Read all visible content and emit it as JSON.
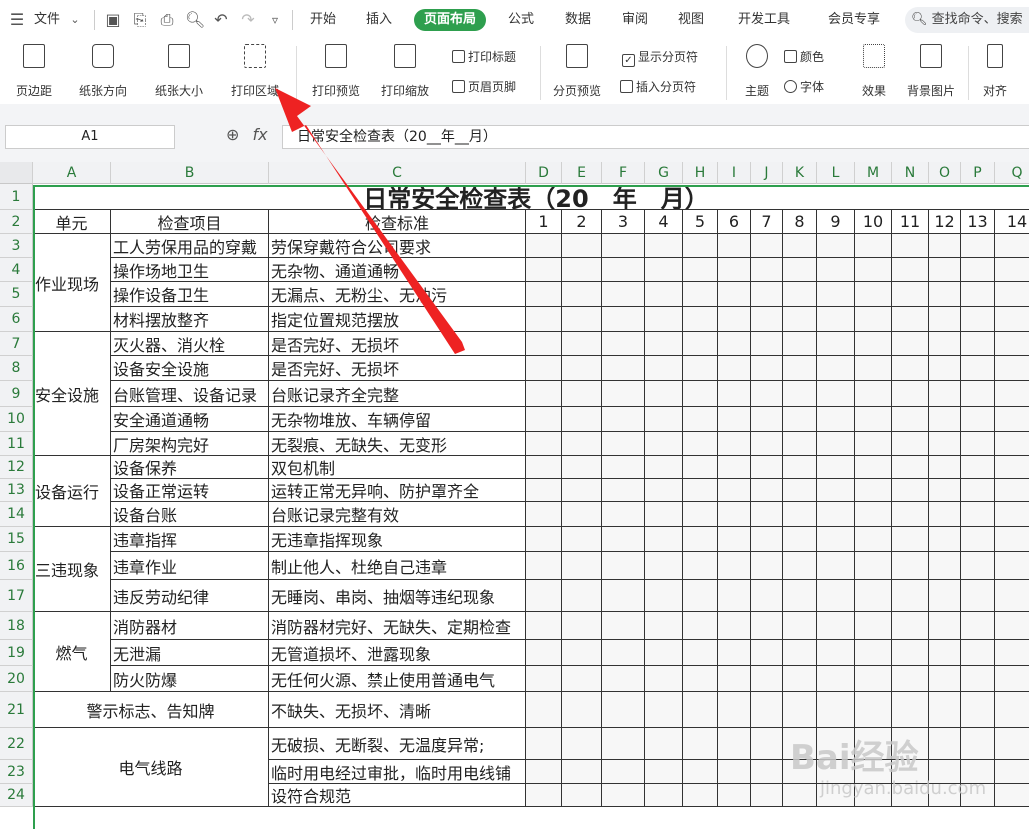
{
  "menubar": {
    "file_label": "文件",
    "tabs": [
      "开始",
      "插入",
      "页面布局",
      "公式",
      "数据",
      "审阅",
      "视图",
      "开发工具",
      "会员专享"
    ],
    "active_tab": "页面布局",
    "search_placeholder": "查找命令、搜索"
  },
  "ribbon": {
    "big_buttons": [
      "页边距",
      "纸张方向",
      "纸张大小",
      "打印区域",
      "打印预览",
      "打印缩放",
      "分页预览",
      "主题",
      "背景图片",
      "对齐"
    ],
    "small_buttons": [
      "打印标题",
      "页眉页脚",
      "显示分页符",
      "插入分页符",
      "颜色",
      "字体",
      "效果"
    ]
  },
  "formula_bar": {
    "cell_ref": "A1",
    "fx": "fx",
    "content": "日常安全检查表（20__年__月）"
  },
  "columns": [
    "A",
    "B",
    "C",
    "D",
    "E",
    "F",
    "G",
    "H",
    "I",
    "J",
    "K",
    "L",
    "M",
    "N",
    "O",
    "P",
    "Q"
  ],
  "rows": [
    "1",
    "2",
    "3",
    "4",
    "5",
    "6",
    "7",
    "8",
    "9",
    "10",
    "11",
    "12",
    "13",
    "14",
    "15",
    "16",
    "17",
    "18",
    "19",
    "20",
    "21",
    "22",
    "23",
    "24"
  ],
  "sheet": {
    "title": "日常安全检查表（20__年__月）",
    "headers": {
      "unit": "单元",
      "item": "检查项目",
      "standard": "检查标准"
    },
    "days": [
      "1",
      "2",
      "3",
      "4",
      "5",
      "6",
      "7",
      "8",
      "9",
      "10",
      "11",
      "12",
      "13",
      "14"
    ],
    "units": [
      {
        "name": "作业现场"
      },
      {
        "name": "安全设施"
      },
      {
        "name": "设备运行"
      },
      {
        "name": "三违现象"
      },
      {
        "name": "燃气"
      },
      {
        "name": "警示标志、告知牌"
      },
      {
        "name": "电气线路"
      }
    ],
    "items": [
      {
        "item": "工人劳保用品的穿戴",
        "standard": "劳保穿戴符合公司要求"
      },
      {
        "item": "操作场地卫生",
        "standard": "无杂物、通道通畅"
      },
      {
        "item": "操作设备卫生",
        "standard": "无漏点、无粉尘、无油污"
      },
      {
        "item": "材料摆放整齐",
        "standard": "指定位置规范摆放"
      },
      {
        "item": "灭火器、消火栓",
        "standard": "是否完好、无损坏"
      },
      {
        "item": "设备安全设施",
        "standard": "是否完好、无损坏"
      },
      {
        "item": "台账管理、设备记录",
        "standard": "台账记录齐全完整"
      },
      {
        "item": "安全通道通畅",
        "standard": "无杂物堆放、车辆停留"
      },
      {
        "item": "厂房架构完好",
        "standard": "无裂痕、无缺失、无变形"
      },
      {
        "item": "设备保养",
        "standard": "双包机制"
      },
      {
        "item": "设备正常运转",
        "standard": "运转正常无异响、防护罩齐全"
      },
      {
        "item": "设备台账",
        "standard": "台账记录完整有效"
      },
      {
        "item": "违章指挥",
        "standard": "无违章指挥现象"
      },
      {
        "item": "违章作业",
        "standard": "制止他人、杜绝自己违章"
      },
      {
        "item": "违反劳动纪律",
        "standard": "无睡岗、串岗、抽烟等违纪现象"
      },
      {
        "item": "消防器材",
        "standard": "消防器材完好、无缺失、定期检查"
      },
      {
        "item": "无泄漏",
        "standard": "无管道损坏、泄露现象"
      },
      {
        "item": "防火防爆",
        "standard": "无任何火源、禁止使用普通电气"
      },
      {
        "item": "",
        "standard": "不缺失、无损坏、清晰"
      },
      {
        "item": "",
        "standard": "无破损、无断裂、无温度异常;"
      },
      {
        "item": "",
        "standard": "临时用电经过审批，临时用电线铺"
      },
      {
        "item": "",
        "standard": "设符合规范"
      }
    ]
  },
  "watermark": {
    "text": "Bai经验",
    "sub": "jingyan.baidu.com"
  }
}
